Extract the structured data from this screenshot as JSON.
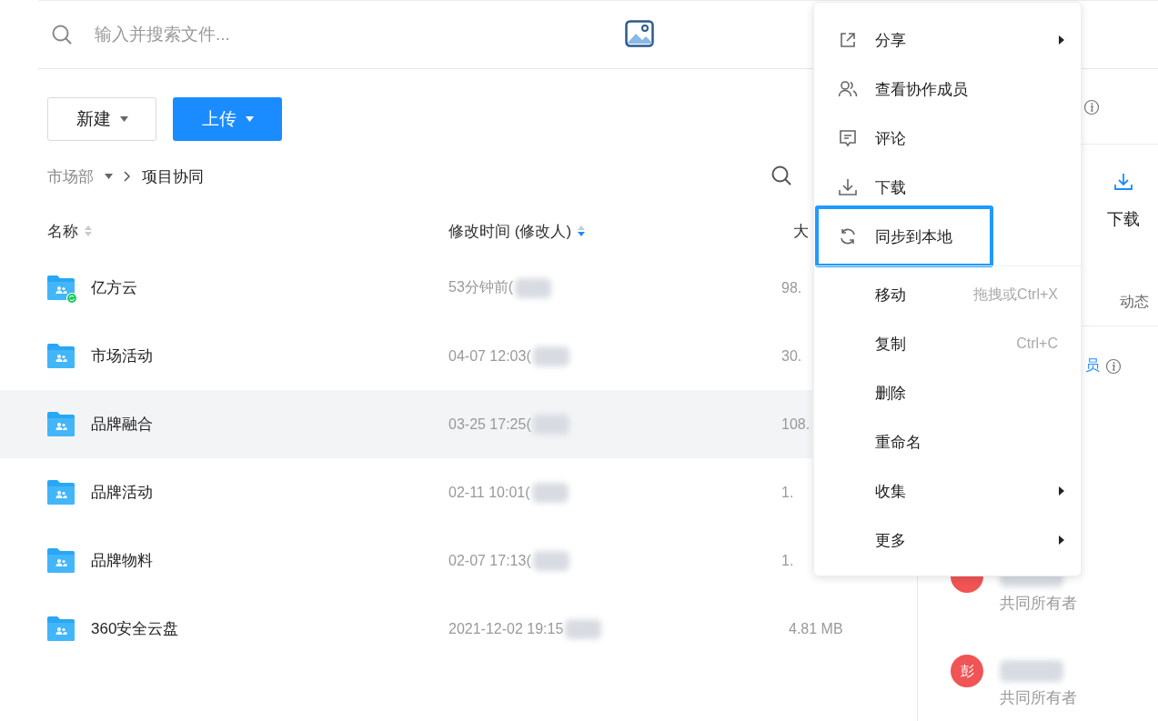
{
  "search": {
    "placeholder": "输入并搜索文件..."
  },
  "toolbar": {
    "buttons": [
      {
        "label": "新建",
        "kind": "default"
      },
      {
        "label": "上传",
        "kind": "primary"
      }
    ]
  },
  "breadcrumb": [
    {
      "label": "市场部",
      "dropdown": true
    },
    {
      "label": "项目协同",
      "dropdown": false
    }
  ],
  "table": {
    "columns": [
      {
        "label": "名称",
        "sorted": false
      },
      {
        "label": "修改时间 (修改人)",
        "sorted": true
      },
      {
        "label": "大"
      }
    ],
    "rows": [
      {
        "name": "亿方云",
        "modified": "53分钟前(",
        "size": "98.",
        "syncing": true,
        "selected": false
      },
      {
        "name": "市场活动",
        "modified": "04-07 12:03(",
        "size": "30.",
        "syncing": false,
        "selected": false
      },
      {
        "name": "品牌融合",
        "modified": "03-25 17:25(",
        "size": "108.",
        "syncing": false,
        "selected": true
      },
      {
        "name": "品牌活动",
        "modified": "02-11 10:01(",
        "size": "1.",
        "syncing": false,
        "selected": false
      },
      {
        "name": "品牌物料",
        "modified": "02-07 17:13(",
        "size": "1.",
        "syncing": false,
        "selected": false
      },
      {
        "name": "360安全云盘",
        "modified": "2021-12-02 19:15",
        "size": "4.81 MB",
        "syncing": false,
        "selected": false
      }
    ]
  },
  "side_panel": {
    "action": {
      "label": "下载"
    },
    "tab": {
      "label": "动态"
    },
    "members_link": "员",
    "members": [
      {
        "role": "共同所有者"
      },
      {
        "avatar": "彭",
        "role": "共同所有者"
      }
    ]
  },
  "context_menu": {
    "groups": [
      [
        {
          "label": "分享",
          "kind": "share",
          "submenu": true,
          "highlighted": false
        },
        {
          "label": "查看协作成员",
          "kind": "members",
          "submenu": false,
          "highlighted": false
        },
        {
          "label": "评论",
          "kind": "comment",
          "submenu": false,
          "highlighted": false
        },
        {
          "label": "下载",
          "kind": "download",
          "submenu": false,
          "highlighted": false
        },
        {
          "label": "同步到本地",
          "kind": "sync",
          "submenu": false,
          "highlighted": true
        }
      ],
      [
        {
          "label": "移动",
          "shortcut": "拖拽或Ctrl+X",
          "submenu": false,
          "highlighted": false
        },
        {
          "label": "复制",
          "shortcut": "Ctrl+C",
          "submenu": false,
          "highlighted": false
        },
        {
          "label": "删除",
          "submenu": false,
          "highlighted": false
        },
        {
          "label": "重命名",
          "submenu": false,
          "highlighted": false
        },
        {
          "label": "收集",
          "submenu": true,
          "highlighted": false
        },
        {
          "label": "更多",
          "submenu": true,
          "highlighted": false
        }
      ]
    ]
  }
}
